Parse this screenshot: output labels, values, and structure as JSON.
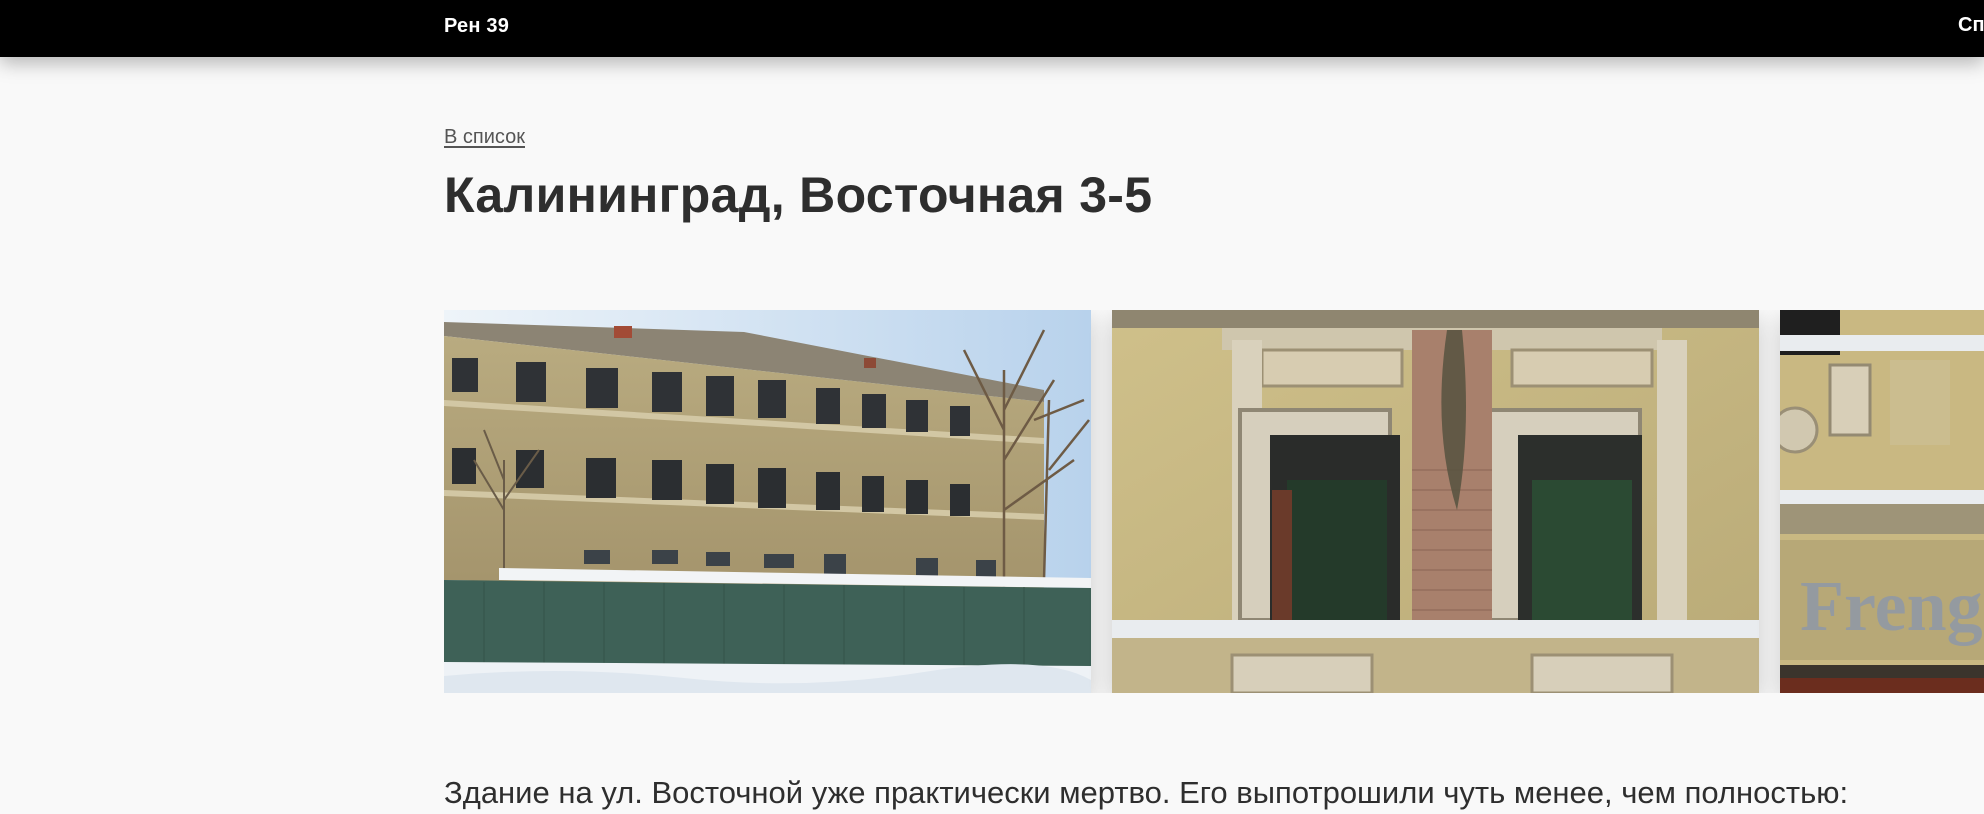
{
  "header": {
    "brand": "Рен 39",
    "nav_link": "Сп"
  },
  "back_link": "В список",
  "page_title": "Калининград, Восточная 3-5",
  "gallery": {
    "photos": [
      {
        "icon": "building-facade-photo"
      },
      {
        "icon": "window-closeup-photo"
      },
      {
        "icon": "facade-signage-photo"
      }
    ]
  },
  "description": "Здание на ул. Восточной уже практически мертво. Его выпотрошили чуть менее, чем полностью:"
}
